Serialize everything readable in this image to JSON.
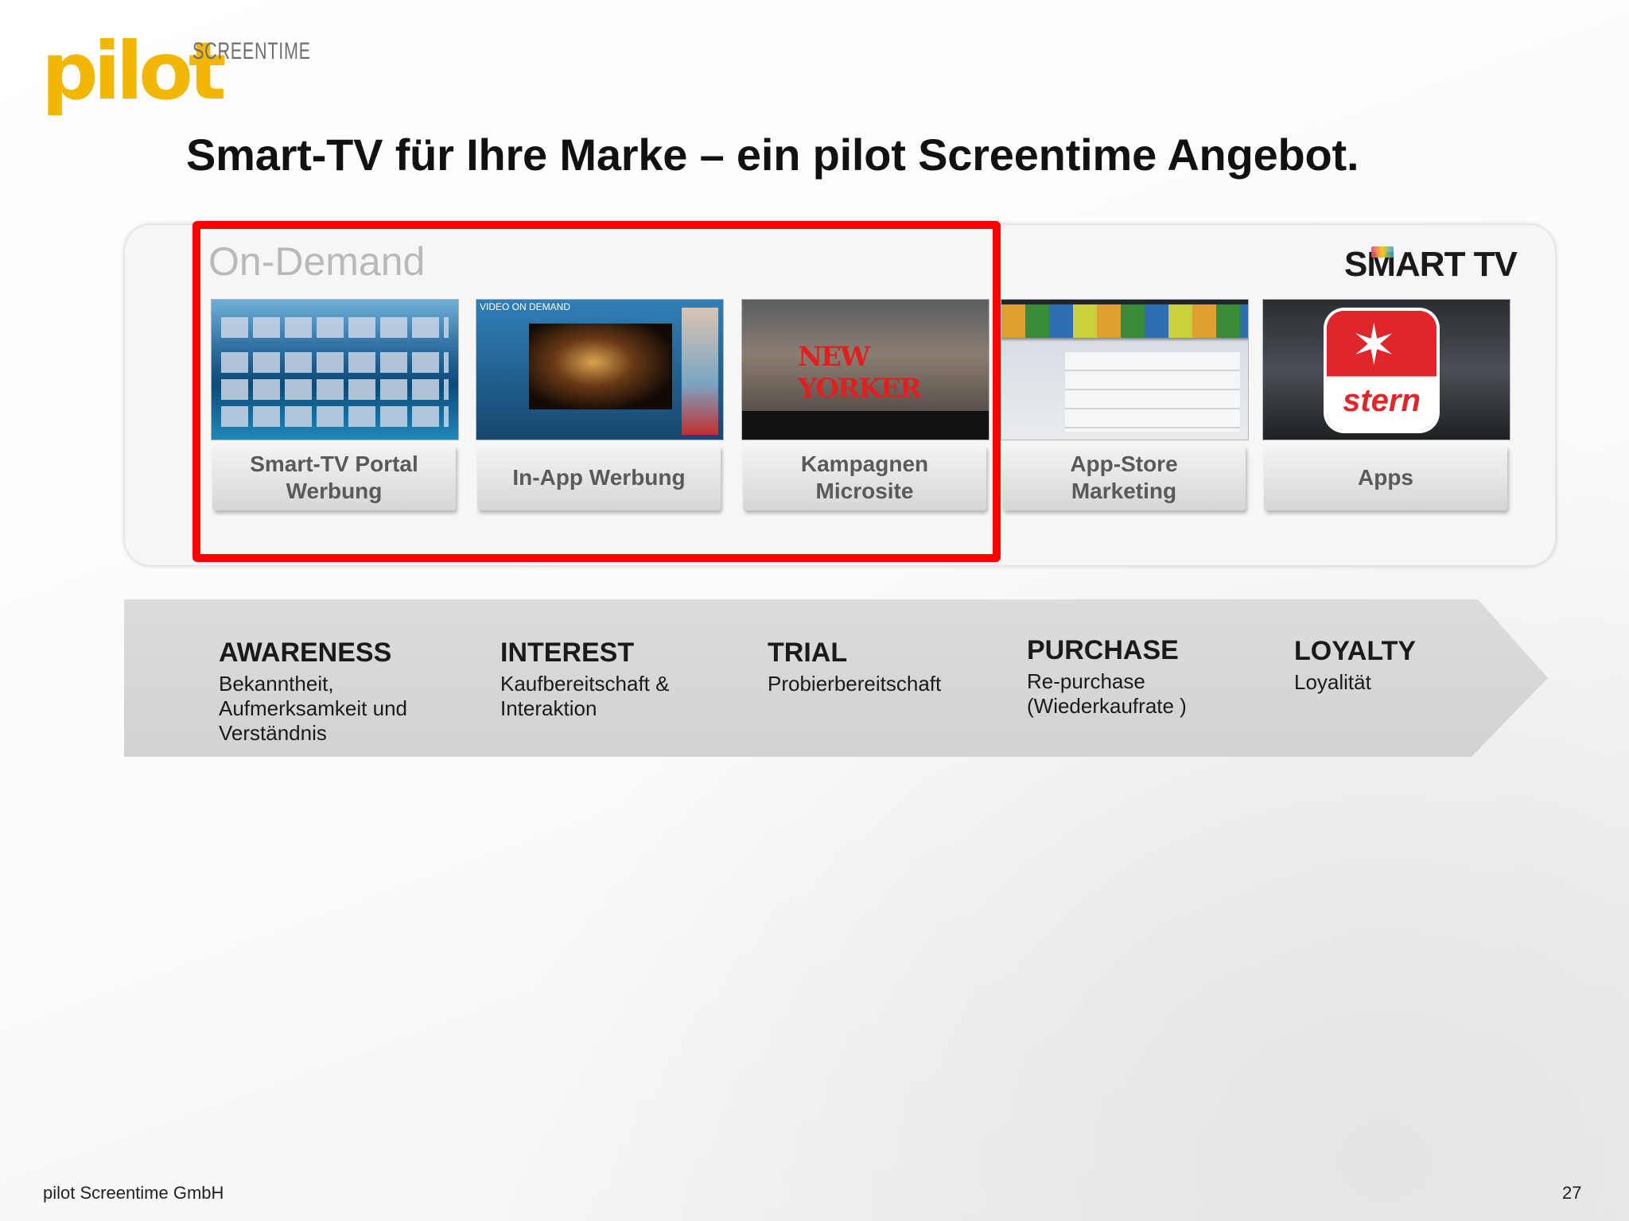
{
  "logo": {
    "wordmark": "pilot",
    "subtitle": "SCREENTIME"
  },
  "title": "Smart-TV für Ihre Marke – ein pilot Screentime Angebot.",
  "panel": {
    "heading": "On-Demand",
    "brand_logo": "SMART TV",
    "highlight_color": "#ff0000",
    "cards": [
      {
        "label": "Smart-TV Portal\nWerbung",
        "thumbnail": "smart-hub-portal"
      },
      {
        "label": "In-App Werbung",
        "thumbnail": "video-on-demand"
      },
      {
        "label": "Kampagnen\nMicrosite",
        "thumbnail": "new-yorker-campaign"
      },
      {
        "label": "App-Store\nMarketing",
        "thumbnail": "samsung-app-store"
      },
      {
        "label": "Apps",
        "thumbnail": "stern-app",
        "app_word": "stern"
      }
    ],
    "thumb_texts": {
      "vod": "VIDEO ON DEMAND",
      "nyk": "NEW YORKER"
    }
  },
  "funnel": [
    {
      "title": "AWARENESS",
      "desc": "Bekanntheit,\nAufmerksamkeit und\nVerständnis"
    },
    {
      "title": "INTEREST",
      "desc": "Kaufbereitschaft &\nInteraktion"
    },
    {
      "title": "TRIAL",
      "desc": "Probierbereitschaft"
    },
    {
      "title": "PURCHASE",
      "desc": "Re-purchase\n(Wiederkaufrate )"
    },
    {
      "title": "LOYALTY",
      "desc": "Loyalität"
    }
  ],
  "footer": {
    "company": "pilot Screentime GmbH",
    "page": "27"
  }
}
